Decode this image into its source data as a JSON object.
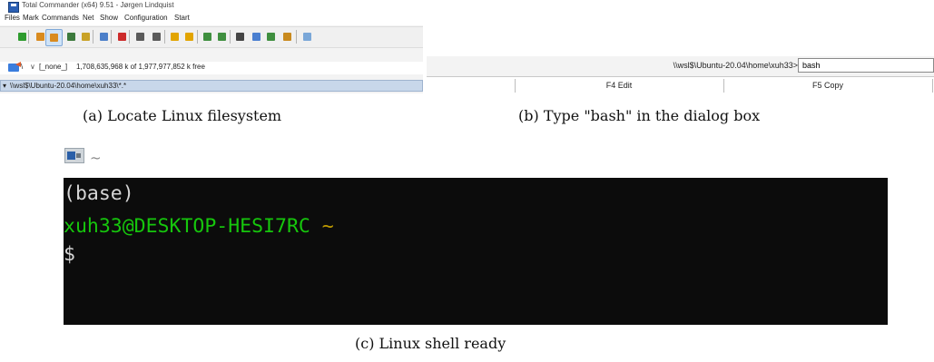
{
  "panel_a": {
    "caption": "(a) Locate Linux filesystem",
    "window_title": "Total Commander (x64) 9.51 - Jørgen Lindquist",
    "menu": [
      "Files",
      "Mark",
      "Commands",
      "Net",
      "Show",
      "Configuration",
      "Start"
    ],
    "toolbar_icons": [
      {
        "name": "reread-icon",
        "color": "#2e9b2e"
      },
      {
        "name": "brief-view-icon",
        "color": "#d98b1f"
      },
      {
        "name": "full-view-icon",
        "color": "#d98b1f",
        "pressed": true
      },
      {
        "name": "thumbnails-icon",
        "color": "#3c7a3c"
      },
      {
        "name": "tree-icon",
        "color": "#c9a227"
      },
      {
        "name": "invert-selection-icon",
        "color": "#4c7fc9"
      },
      {
        "name": "unselect-icon",
        "color": "#cc2b2b"
      },
      {
        "name": "back-icon",
        "color": "#5a5a5a"
      },
      {
        "name": "forward-icon",
        "color": "#5a5a5a"
      },
      {
        "name": "pack-icon",
        "color": "#e2a400"
      },
      {
        "name": "unpack-icon",
        "color": "#e2a400"
      },
      {
        "name": "ftp-icon",
        "color": "#3f8f3f"
      },
      {
        "name": "url-icon",
        "color": "#3f8f3f"
      },
      {
        "name": "find-icon",
        "color": "#444444"
      },
      {
        "name": "multi-rename-icon",
        "color": "#4a7fd0"
      },
      {
        "name": "compare-icon",
        "color": "#3f8f3f"
      },
      {
        "name": "sync-icon",
        "color": "#c98a1e"
      },
      {
        "name": "notepad-icon",
        "color": "#7aa7d8"
      }
    ],
    "drive": {
      "separator": "\\",
      "label": "[_none_]",
      "free_space": "1,708,635,968 k of 1,977,977,852 k free"
    },
    "path": "\\\\wsl$\\Ubuntu-20.04\\home\\xuh33\\*.*"
  },
  "panel_b": {
    "caption": "(b) Type \"bash\" in the dialog box",
    "path_prompt": "\\\\wsl$\\Ubuntu-20.04\\home\\xuh33>",
    "command_value": "bash",
    "function_keys": [
      "F4 Edit",
      "F5 Copy"
    ]
  },
  "panel_c": {
    "caption": "(c) Linux shell ready",
    "tab_title": "~",
    "terminal": {
      "line1": "(base)",
      "user_host": "xuh33@DESKTOP-HESI7RC",
      "tilde": "~",
      "prompt": "$"
    },
    "colors": {
      "background": "#0c0c0c",
      "user_green": "#16c60c",
      "tilde_yellow": "#c19c00",
      "text": "#d6d6d6"
    }
  }
}
